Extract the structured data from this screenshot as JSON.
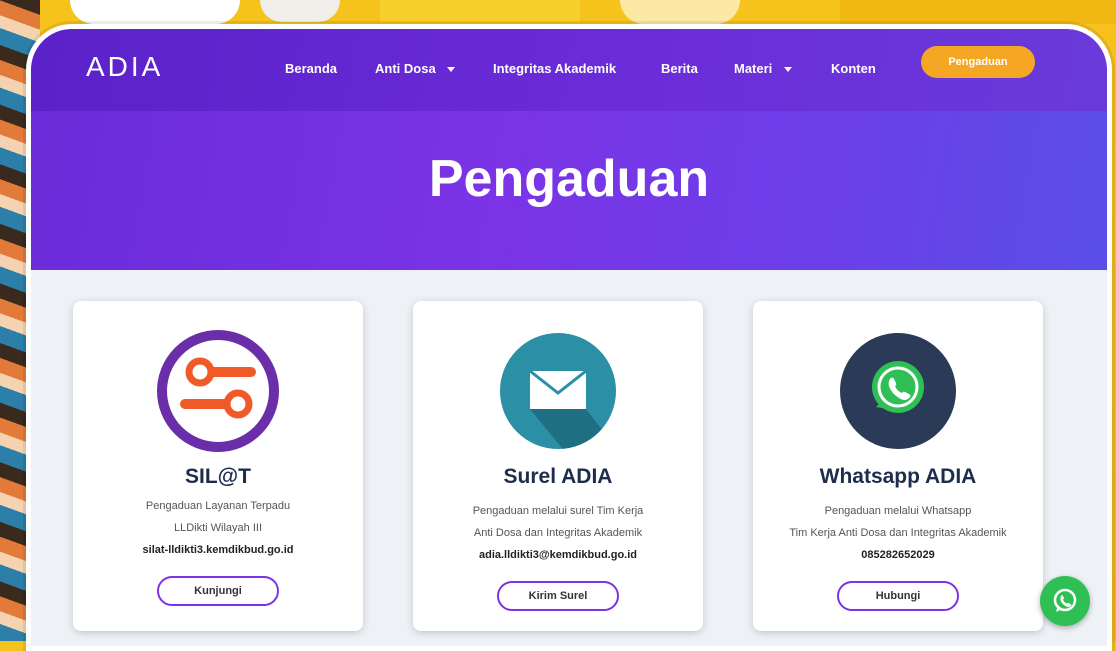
{
  "brand": {
    "logo": "ADIA"
  },
  "nav": {
    "items": [
      {
        "label": "Beranda"
      },
      {
        "label": "Anti Dosa"
      },
      {
        "label": "Integritas Akademik"
      },
      {
        "label": "Berita"
      },
      {
        "label": "Materi"
      },
      {
        "label": "Konten"
      }
    ],
    "cta": "Pengaduan"
  },
  "hero": {
    "title": "Pengaduan"
  },
  "cards": [
    {
      "title": "SIL@T",
      "line1": "Pengaduan Layanan Terpadu",
      "line2": "LLDikti Wilayah III",
      "contact": "silat-lldikti3.kemdikbud.go.id",
      "button": "Kunjungi",
      "icon": "toggle-link-icon"
    },
    {
      "title": "Surel ADIA",
      "line1": "Pengaduan melalui surel Tim Kerja",
      "line2": "Anti Dosa dan Integritas Akademik",
      "contact": "adia.lldikti3@kemdikbud.go.id",
      "button": "Kirim Surel",
      "icon": "envelope-icon"
    },
    {
      "title": "Whatsapp ADIA",
      "line1": "Pengaduan melalui Whatsapp",
      "line2": "Tim Kerja Anti Dosa dan Integritas Akademik",
      "contact": "085282652029",
      "button": "Hubungi",
      "icon": "whatsapp-icon"
    }
  ],
  "colors": {
    "primary": "#6a2bd9",
    "accent": "#f5a623",
    "silat_ring": "#6a2fa8",
    "silat_orange": "#f05a28",
    "mail_teal": "#2b8fa6",
    "wa_dark": "#2b3a56",
    "wa_green": "#2fbf55"
  }
}
